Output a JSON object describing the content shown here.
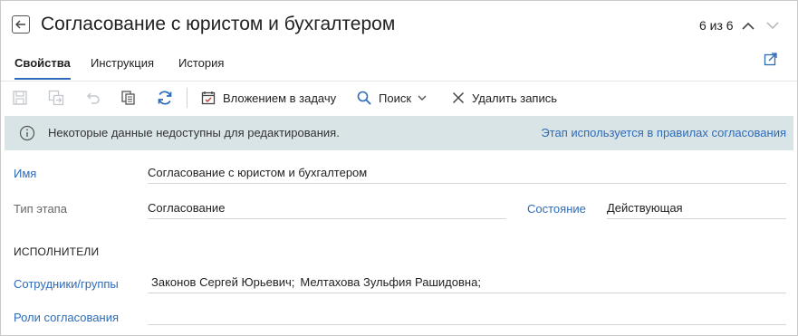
{
  "header": {
    "title": "Согласование с юристом и бухгалтером",
    "counter": "6 из 6"
  },
  "tabs": [
    {
      "label": "Свойства",
      "active": true
    },
    {
      "label": "Инструкция",
      "active": false
    },
    {
      "label": "История",
      "active": false
    }
  ],
  "toolbar": {
    "attach_label": "Вложением в задачу",
    "search_label": "Поиск",
    "delete_label": "Удалить запись"
  },
  "info": {
    "message": "Некоторые данные недоступны для редактирования.",
    "link": "Этап используется в правилах согласования"
  },
  "form": {
    "name_label": "Имя",
    "name_value": "Согласование с юристом и бухгалтером",
    "stage_type_label": "Тип этапа",
    "stage_type_value": "Согласование",
    "state_label": "Состояние",
    "state_value": "Действующая",
    "section_title": "ИСПОЛНИТЕЛИ",
    "employees_label": "Сотрудники/группы",
    "employees": [
      "Законов Сергей Юрьевич;",
      "Мелтахова Зульфия Рашидовна;"
    ],
    "roles_label": "Роли согласования",
    "roles_value": ""
  },
  "colors": {
    "accent": "#2e6bb8",
    "info_bg": "#d9e4e6",
    "refresh_icon": "#2e6bb8"
  }
}
